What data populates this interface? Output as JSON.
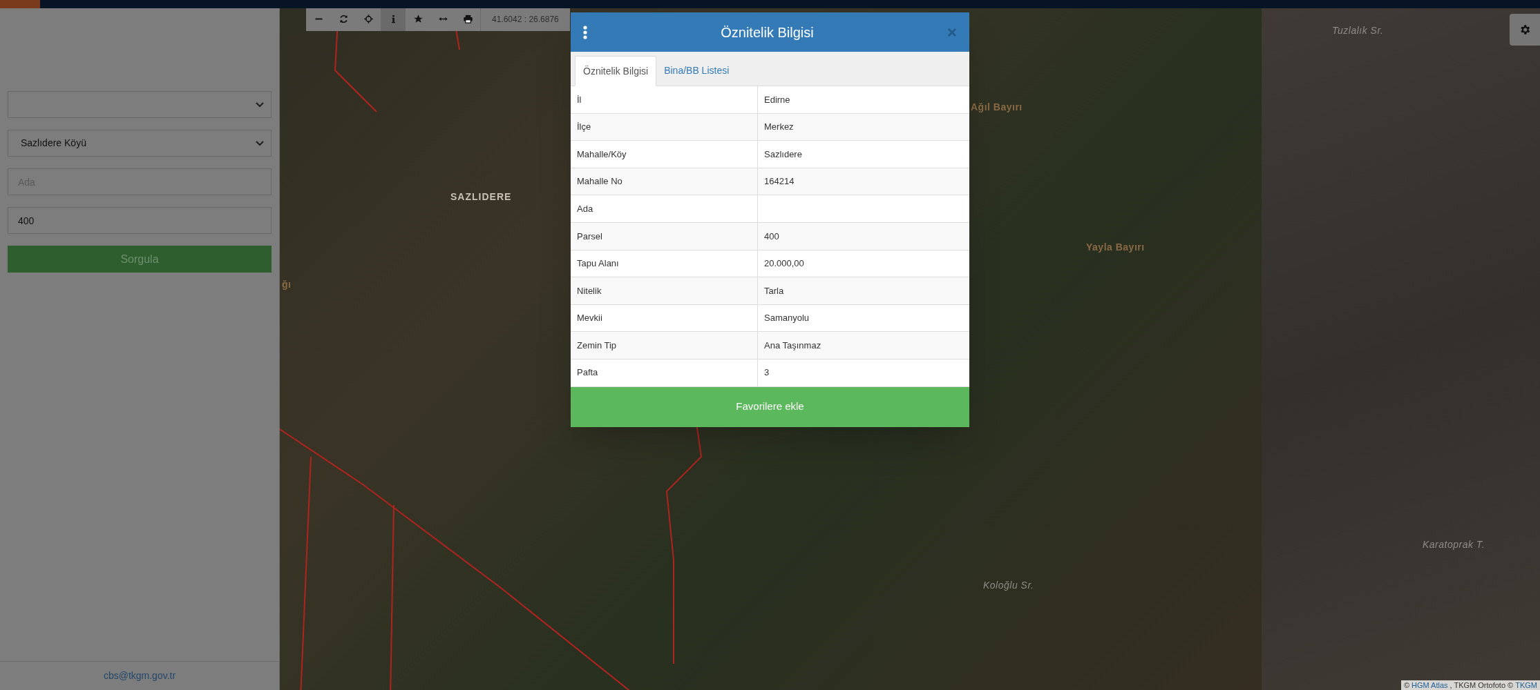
{
  "sidebar": {
    "fields": [
      {
        "kind": "select"
      },
      {
        "kind": "select",
        "value": "Sazlıdere Köyü"
      },
      {
        "kind": "input",
        "placeholder": "Ada"
      },
      {
        "kind": "input",
        "value": "400"
      }
    ],
    "submit": "Sorgula",
    "footer_link": "cbs@tkgm.gov.tr"
  },
  "toolbar": {
    "buttons": [
      {
        "selected": false
      },
      {
        "selected": false
      },
      {
        "selected": false
      },
      {
        "selected": true
      },
      {
        "selected": false
      },
      {
        "selected": false
      },
      {
        "selected": false
      }
    ],
    "coordinates": "41.6042 : 26.6876"
  },
  "map": {
    "labels": [
      {
        "kind": "settlement",
        "text": "SAZLIDERE"
      },
      {
        "kind": "hill",
        "text": "Ağıl Bayırı"
      },
      {
        "kind": "hill",
        "text": "Yayla Bayırı"
      },
      {
        "kind": "feature",
        "text": "Tuzlalık Sr."
      },
      {
        "kind": "feature",
        "text": "Koloğlu Sr."
      },
      {
        "kind": "feature",
        "text": "Karatoprak T."
      },
      {
        "kind": "hill",
        "text": "ğı"
      }
    ],
    "attribution": [
      {
        "kind": "text",
        "text": "©"
      },
      {
        "kind": "link",
        "text": "HGM Atlas"
      },
      {
        "kind": "text",
        "text": ", TKGM Ortofoto ©"
      },
      {
        "kind": "link",
        "text": "TKGM"
      }
    ]
  },
  "dialog": {
    "title": "Öznitelik Bilgisi",
    "tabs": [
      {
        "label": "Öznitelik Bilgisi",
        "selected": true
      },
      {
        "label": "Bina/BB Listesi",
        "selected": false
      }
    ],
    "rows": [
      {
        "label": "İl",
        "value": "Edirne"
      },
      {
        "label": "İlçe",
        "value": "Merkez"
      },
      {
        "label": "Mahalle/Köy",
        "value": "Sazlıdere"
      },
      {
        "label": "Mahalle No",
        "value": "164214"
      },
      {
        "label": "Ada"
      },
      {
        "label": "Parsel",
        "value": "400"
      },
      {
        "label": "Tapu Alanı",
        "value": "20.000,00"
      },
      {
        "label": "Nitelik",
        "value": "Tarla"
      },
      {
        "label": "Mevkii",
        "value": "Samanyolu"
      },
      {
        "label": "Zemin Tip",
        "value": "Ana Taşınmaz"
      },
      {
        "label": "Pafta",
        "value": "3"
      }
    ],
    "action": "Favorilere ekle"
  }
}
